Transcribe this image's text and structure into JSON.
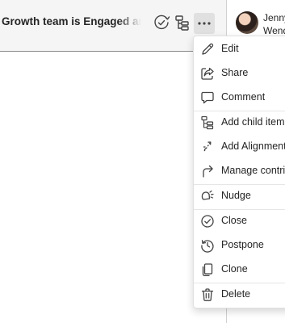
{
  "header": {
    "title": "Growth team is Engaged and Th"
  },
  "user": {
    "name_line1": "Jenny",
    "name_line2": "Wend"
  },
  "menu": {
    "items": [
      {
        "label": "Edit",
        "icon": "pencil-icon"
      },
      {
        "label": "Share",
        "icon": "share-icon"
      },
      {
        "label": "Comment",
        "icon": "comment-icon"
      },
      {
        "label": "Add child items",
        "icon": "hierarchy-icon"
      },
      {
        "label": "Add Alignment",
        "icon": "alignment-icon"
      },
      {
        "label": "Manage contrib",
        "icon": "forward-arrow-icon"
      },
      {
        "label": "Nudge",
        "icon": "nudge-icon"
      },
      {
        "label": "Close",
        "icon": "checkmark-circle-icon"
      },
      {
        "label": "Postpone",
        "icon": "history-icon"
      },
      {
        "label": "Clone",
        "icon": "copy-icon"
      },
      {
        "label": "Delete",
        "icon": "trash-icon"
      }
    ]
  }
}
